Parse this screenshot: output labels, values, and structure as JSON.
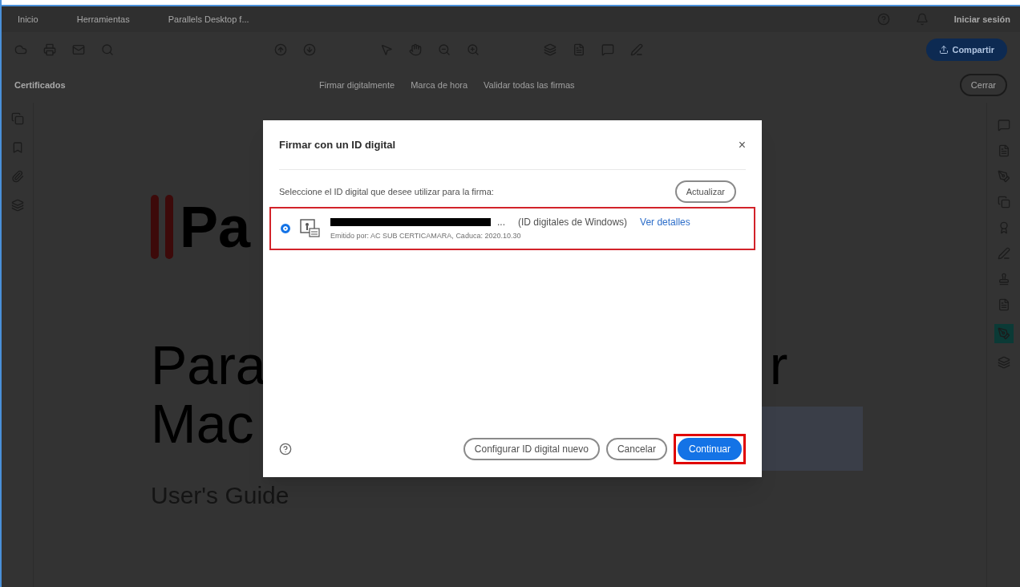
{
  "top_menu": {
    "tabs": [
      "Inicio",
      "Herramientas",
      "Parallels Desktop f..."
    ],
    "sign_in": "Iniciar sesión"
  },
  "toolbar": {
    "share": "Compartir"
  },
  "cert_bar": {
    "title": "Certificados",
    "tools": [
      "Firmar digitalmente",
      "Marca de hora",
      "Validar todas las firmas"
    ],
    "close": "Cerrar"
  },
  "document": {
    "logo_text": "Pa",
    "title_lines": [
      "Para",
      "Mac"
    ],
    "title_tail": "r",
    "subtitle": "User's Guide"
  },
  "dialog": {
    "title": "Firmar con un ID digital",
    "close": "×",
    "prompt": "Seleccione el ID digital que desee utilizar para la firma:",
    "refresh": "Actualizar",
    "ids": [
      {
        "selected": true,
        "highlighted": true,
        "name_tail": "...",
        "store": "(ID digitales de Windows)",
        "details": "Ver detalles",
        "issuer": "Emitido por: AC SUB CERTICAMARA, Caduca: 2020.10.30"
      }
    ],
    "buttons": [
      {
        "label": "Configurar ID digital nuevo",
        "kind": "secondary",
        "highlighted": false
      },
      {
        "label": "Cancelar",
        "kind": "secondary",
        "highlighted": false
      },
      {
        "label": "Continuar",
        "kind": "primary",
        "highlighted": true
      }
    ]
  }
}
